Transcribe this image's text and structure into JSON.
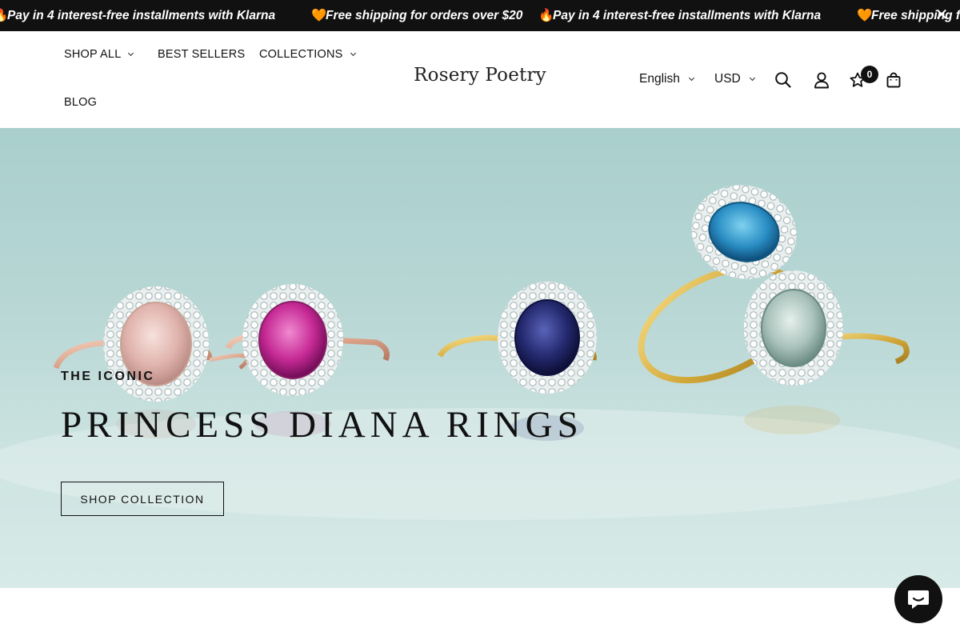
{
  "announcement": {
    "messages": [
      {
        "emoji": "🔥",
        "text": "Pay in 4 interest-free installments with Klarna"
      },
      {
        "emoji": "🧡",
        "text": "Free shipping for orders over $20"
      },
      {
        "emoji": "🔥",
        "text": "Pay in 4 interest-free installments with Klarna"
      },
      {
        "emoji": "🧡",
        "text": "Free shipping fo"
      }
    ],
    "close_icon": "close-icon"
  },
  "header": {
    "nav": {
      "shop_all": "SHOP ALL",
      "best_sellers": "BEST SELLERS",
      "collections": "COLLECTIONS",
      "blog": "BLOG"
    },
    "logo": "Rosery Poetry",
    "language": "English",
    "currency": "USD",
    "wishlist_count": "0",
    "icons": [
      "search-icon",
      "account-icon",
      "star-icon",
      "bag-icon"
    ]
  },
  "hero": {
    "eyebrow": "THE ICONIC",
    "headline": "PRINCESS DIANA RINGS",
    "cta": "SHOP COLLECTION"
  },
  "colors": {
    "announcement_bg": "#111111",
    "hero_bg": "#b8d7d5",
    "text": "#111111"
  },
  "chat_icon": "chat-icon"
}
